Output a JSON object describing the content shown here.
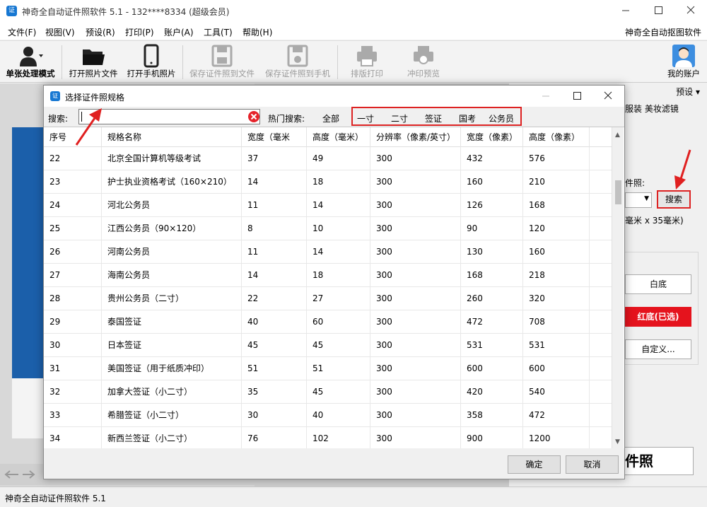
{
  "window": {
    "title": "神奇全自动证件照软件 5.1 - 132****8334 (超级会员)",
    "icon_text": "证"
  },
  "menu": {
    "items": [
      "文件(F)",
      "视图(V)",
      "预设(R)",
      "打印(P)",
      "账户(A)",
      "工具(T)",
      "帮助(H)"
    ],
    "right_link": "神奇全自动抠图软件"
  },
  "toolbar": {
    "single_mode": "单张处理模式",
    "open_file": "打开照片文件",
    "open_phone": "打开手机照片",
    "save_file": "保存证件照到文件",
    "save_phone": "保存证件照到手机",
    "layout_print": "排版打印",
    "print_preview": "冲印预览",
    "my_account": "我的账户"
  },
  "right_panel": {
    "preset": "预设",
    "tabs": "服装  美妆滤镜",
    "spec_label": "件照:",
    "search_button": "搜索",
    "size_text": "毫米 x 35毫米)",
    "bg_white": "白底",
    "bg_red": "红底(已选)",
    "bg_custom": "自定义...",
    "make_button": "件照"
  },
  "status": {
    "text": "神奇全自动证件照软件 5.1"
  },
  "dialog": {
    "title": "选择证件照规格",
    "search_label": "搜索:",
    "search_value": "",
    "hot_label": "热门搜索:",
    "hot_all": "全部",
    "hot_items": [
      "一寸",
      "二寸",
      "签证",
      "国考",
      "公务员"
    ],
    "columns": [
      "序号",
      "规格名称",
      "宽度（毫米",
      "高度（毫米）",
      "分辨率（像素/英寸）",
      "宽度（像素）",
      "高度（像素）"
    ],
    "rows": [
      {
        "no": "22",
        "name": "北京全国计算机等级考试",
        "wmm": "37",
        "hmm": "49",
        "dpi": "300",
        "wpx": "432",
        "hpx": "576"
      },
      {
        "no": "23",
        "name": "护士执业资格考试（160×210）",
        "wmm": "14",
        "hmm": "18",
        "dpi": "300",
        "wpx": "160",
        "hpx": "210"
      },
      {
        "no": "24",
        "name": "河北公务员",
        "wmm": "11",
        "hmm": "14",
        "dpi": "300",
        "wpx": "126",
        "hpx": "168"
      },
      {
        "no": "25",
        "name": "江西公务员（90×120）",
        "wmm": "8",
        "hmm": "10",
        "dpi": "300",
        "wpx": "90",
        "hpx": "120"
      },
      {
        "no": "26",
        "name": "河南公务员",
        "wmm": "11",
        "hmm": "14",
        "dpi": "300",
        "wpx": "130",
        "hpx": "160"
      },
      {
        "no": "27",
        "name": "海南公务员",
        "wmm": "14",
        "hmm": "18",
        "dpi": "300",
        "wpx": "168",
        "hpx": "218"
      },
      {
        "no": "28",
        "name": "贵州公务员（二寸）",
        "wmm": "22",
        "hmm": "27",
        "dpi": "300",
        "wpx": "260",
        "hpx": "320"
      },
      {
        "no": "29",
        "name": "泰国签证",
        "wmm": "40",
        "hmm": "60",
        "dpi": "300",
        "wpx": "472",
        "hpx": "708"
      },
      {
        "no": "30",
        "name": "日本签证",
        "wmm": "45",
        "hmm": "45",
        "dpi": "300",
        "wpx": "531",
        "hpx": "531"
      },
      {
        "no": "31",
        "name": "美国签证（用于纸质冲印）",
        "wmm": "51",
        "hmm": "51",
        "dpi": "300",
        "wpx": "600",
        "hpx": "600"
      },
      {
        "no": "32",
        "name": "加拿大签证（小二寸）",
        "wmm": "35",
        "hmm": "45",
        "dpi": "300",
        "wpx": "420",
        "hpx": "540"
      },
      {
        "no": "33",
        "name": "希腊签证（小二寸）",
        "wmm": "30",
        "hmm": "40",
        "dpi": "300",
        "wpx": "358",
        "hpx": "472"
      },
      {
        "no": "34",
        "name": "新西兰签证（小二寸）",
        "wmm": "76",
        "hmm": "102",
        "dpi": "300",
        "wpx": "900",
        "hpx": "1200"
      }
    ],
    "ok": "确定",
    "cancel": "取消"
  },
  "colors": {
    "accent_blue": "#1677d2",
    "highlight_red": "#dd2222",
    "selected_red": "#e5131d"
  }
}
